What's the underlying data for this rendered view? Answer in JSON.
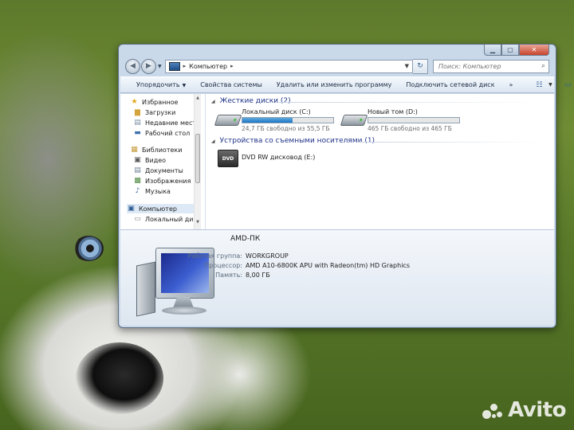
{
  "desktop": {
    "watermark": "Avito"
  },
  "window": {
    "address": {
      "crumb": "Компьютер"
    },
    "search": {
      "placeholder": "Поиск: Компьютер"
    },
    "toolbar": {
      "organize": "Упорядочить",
      "system_props": "Свойства системы",
      "uninstall": "Удалить или изменить программу",
      "map_drive": "Подключить сетевой диск",
      "more": "»"
    },
    "nav": {
      "favorites": "Избранное",
      "downloads": "Загрузки",
      "recent": "Недавние места",
      "desktop": "Рабочий стол",
      "libraries": "Библиотеки",
      "video": "Видео",
      "documents": "Документы",
      "images": "Изображения",
      "music": "Музыка",
      "computer": "Компьютер",
      "local_disk": "Локальный диск"
    },
    "groups": {
      "hard_disks": "Жесткие диски (2)",
      "removable": "Устройства со съемными носителями (1)"
    },
    "drives": [
      {
        "name": "Локальный диск (C:)",
        "free": "24,7 ГБ свободно из 55,5 ГБ",
        "used_fraction": 0.555
      },
      {
        "name": "Новый том (D:)",
        "free": "465 ГБ свободно из 465 ГБ",
        "used_fraction": 0.0
      },
      {
        "name": "DVD RW дисковод (E:)",
        "label": "DVD"
      }
    ],
    "details": {
      "pc_name": "AMD-ПК",
      "workgroup_label": "Рабочая группа:",
      "workgroup": "WORKGROUP",
      "cpu_label": "Процессор:",
      "cpu": "AMD A10-6800K APU with Radeon(tm) HD Graphics",
      "ram_label": "Память:",
      "ram": "8,00 ГБ"
    }
  }
}
